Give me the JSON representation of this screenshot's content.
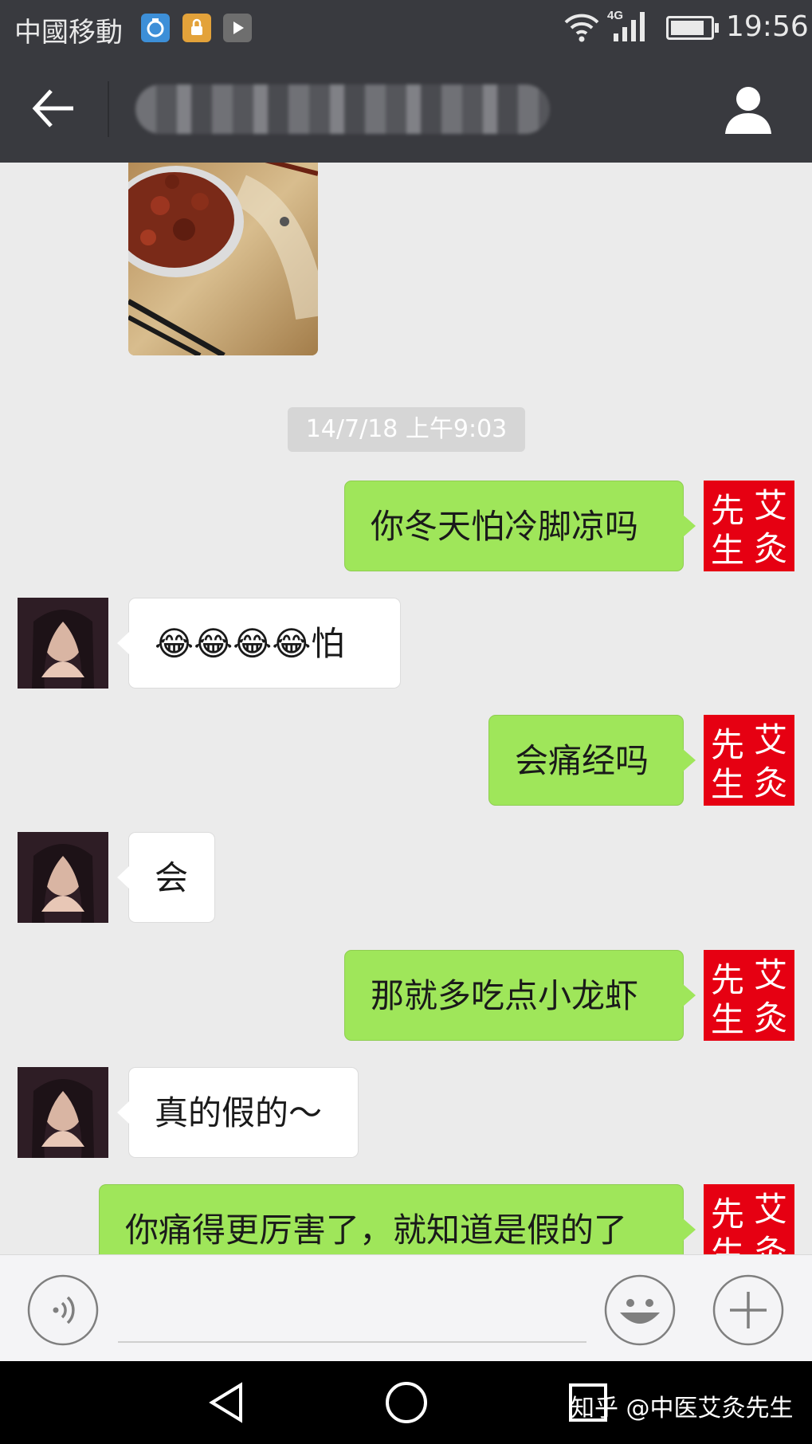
{
  "status_bar": {
    "carrier": "中國移動",
    "network": "4G",
    "time": "19:56",
    "battery_level": 0.85,
    "icons": [
      "app-notification-icon",
      "lock-app-icon",
      "media-app-icon",
      "wifi-icon",
      "signal-icon",
      "battery-icon"
    ]
  },
  "header": {
    "title": "",
    "title_blurred": true,
    "back_icon": "arrow-left-icon",
    "profile_icon": "person-icon"
  },
  "messages": [
    {
      "type": "image",
      "side": "left",
      "content": "photo of crawfish in a bowl on a wooden table"
    },
    {
      "type": "timestamp",
      "text": "14/7/18 上午9:03"
    },
    {
      "type": "text",
      "side": "right",
      "text": "你冬天怕冷脚凉吗"
    },
    {
      "type": "text",
      "side": "left",
      "text": "😂😂😂😂怕"
    },
    {
      "type": "text",
      "side": "right",
      "text": "会痛经吗"
    },
    {
      "type": "text",
      "side": "left",
      "text": "会"
    },
    {
      "type": "text",
      "side": "right",
      "text": "那就多吃点小龙虾"
    },
    {
      "type": "text",
      "side": "left",
      "text": "真的假的～"
    },
    {
      "type": "text",
      "side": "right",
      "text": "你痛得更厉害了，就知道是假的了"
    }
  ],
  "my_avatar": {
    "text_top_right": "艾",
    "text_top_left": "先",
    "text_bottom_right": "灸",
    "text_bottom_left": "生",
    "color": "#e60012"
  },
  "input_bar": {
    "value": "",
    "voice_icon": "voice-icon",
    "emoji_icon": "emoji-icon",
    "plus_icon": "plus-icon"
  },
  "system_nav": {
    "watermark": "知乎 @中医艾灸先生"
  },
  "colors": {
    "bar_dark": "#393a3f",
    "chat_bg": "#ebebeb",
    "bubble_out": "#9fe65a",
    "bubble_in": "#ffffff"
  }
}
